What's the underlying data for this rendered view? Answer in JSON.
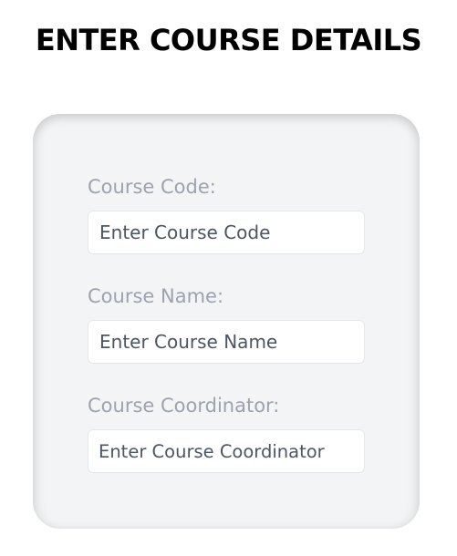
{
  "page": {
    "title": "ENTER COURSE DETAILS"
  },
  "form": {
    "fields": [
      {
        "label": "Course Code:",
        "placeholder": "Enter Course Code",
        "value": ""
      },
      {
        "label": "Course Name:",
        "placeholder": "Enter Course Name",
        "value": ""
      },
      {
        "label": "Course Coordinator:",
        "placeholder": "Enter Course Coordinator",
        "value": ""
      }
    ]
  },
  "colors": {
    "title": "#000000",
    "card_background": "#f3f4f6",
    "label": "#9ca3af",
    "input_background": "#ffffff",
    "input_border": "#e5e7eb",
    "placeholder": "#4b5563"
  }
}
